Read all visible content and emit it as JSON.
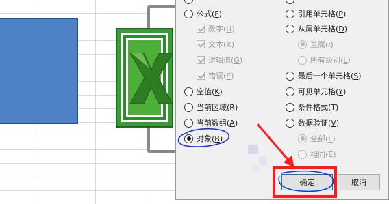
{
  "dialog": {
    "left_column": [
      {
        "label": "公式",
        "key": "F",
        "type": "radio",
        "checked": false,
        "disabled": false
      },
      {
        "label": "数字",
        "key": "U",
        "type": "checkbox",
        "checked": true,
        "disabled": true
      },
      {
        "label": "文本",
        "key": "X",
        "type": "checkbox",
        "checked": true,
        "disabled": true
      },
      {
        "label": "逻辑值",
        "key": "G",
        "type": "checkbox",
        "checked": true,
        "disabled": true
      },
      {
        "label": "错误",
        "key": "E",
        "type": "checkbox",
        "checked": true,
        "disabled": true
      },
      {
        "label": "空值",
        "key": "K",
        "type": "radio",
        "checked": false,
        "disabled": false
      },
      {
        "label": "当前区域",
        "key": "R",
        "type": "radio",
        "checked": false,
        "disabled": false
      },
      {
        "label": "当前数组",
        "key": "A",
        "type": "radio",
        "checked": false,
        "disabled": false
      },
      {
        "label": "对象",
        "key": "B",
        "type": "radio",
        "checked": true,
        "disabled": false
      }
    ],
    "right_column": [
      {
        "label": "引用单元格",
        "key": "P",
        "type": "radio",
        "checked": false,
        "disabled": false
      },
      {
        "label": "从属单元格",
        "key": "D",
        "type": "radio",
        "checked": false,
        "disabled": false
      },
      {
        "label": "直属",
        "key": "I",
        "type": "radio",
        "checked": true,
        "disabled": true
      },
      {
        "label": "所有级别",
        "key": "L",
        "type": "radio",
        "checked": false,
        "disabled": true
      },
      {
        "label": "最后一个单元格",
        "key": "S",
        "type": "radio",
        "checked": false,
        "disabled": false
      },
      {
        "label": "可见单元格",
        "key": "Y",
        "type": "radio",
        "checked": false,
        "disabled": false
      },
      {
        "label": "条件格式",
        "key": "T",
        "type": "radio",
        "checked": false,
        "disabled": false
      },
      {
        "label": "数据验证",
        "key": "V",
        "type": "radio",
        "checked": false,
        "disabled": false
      },
      {
        "label": "全部",
        "key": "L",
        "type": "radio",
        "checked": true,
        "disabled": true
      },
      {
        "label": "相同",
        "key": "E",
        "type": "radio",
        "checked": false,
        "disabled": true
      }
    ],
    "ok_label": "确定",
    "cancel_label": "取消"
  },
  "colors": {
    "annotation_red": "#ff1a1a",
    "annotation_blue": "#1a2ee6",
    "shape_blue": "#4f81c7",
    "excel_green": "#2e8b2e"
  }
}
